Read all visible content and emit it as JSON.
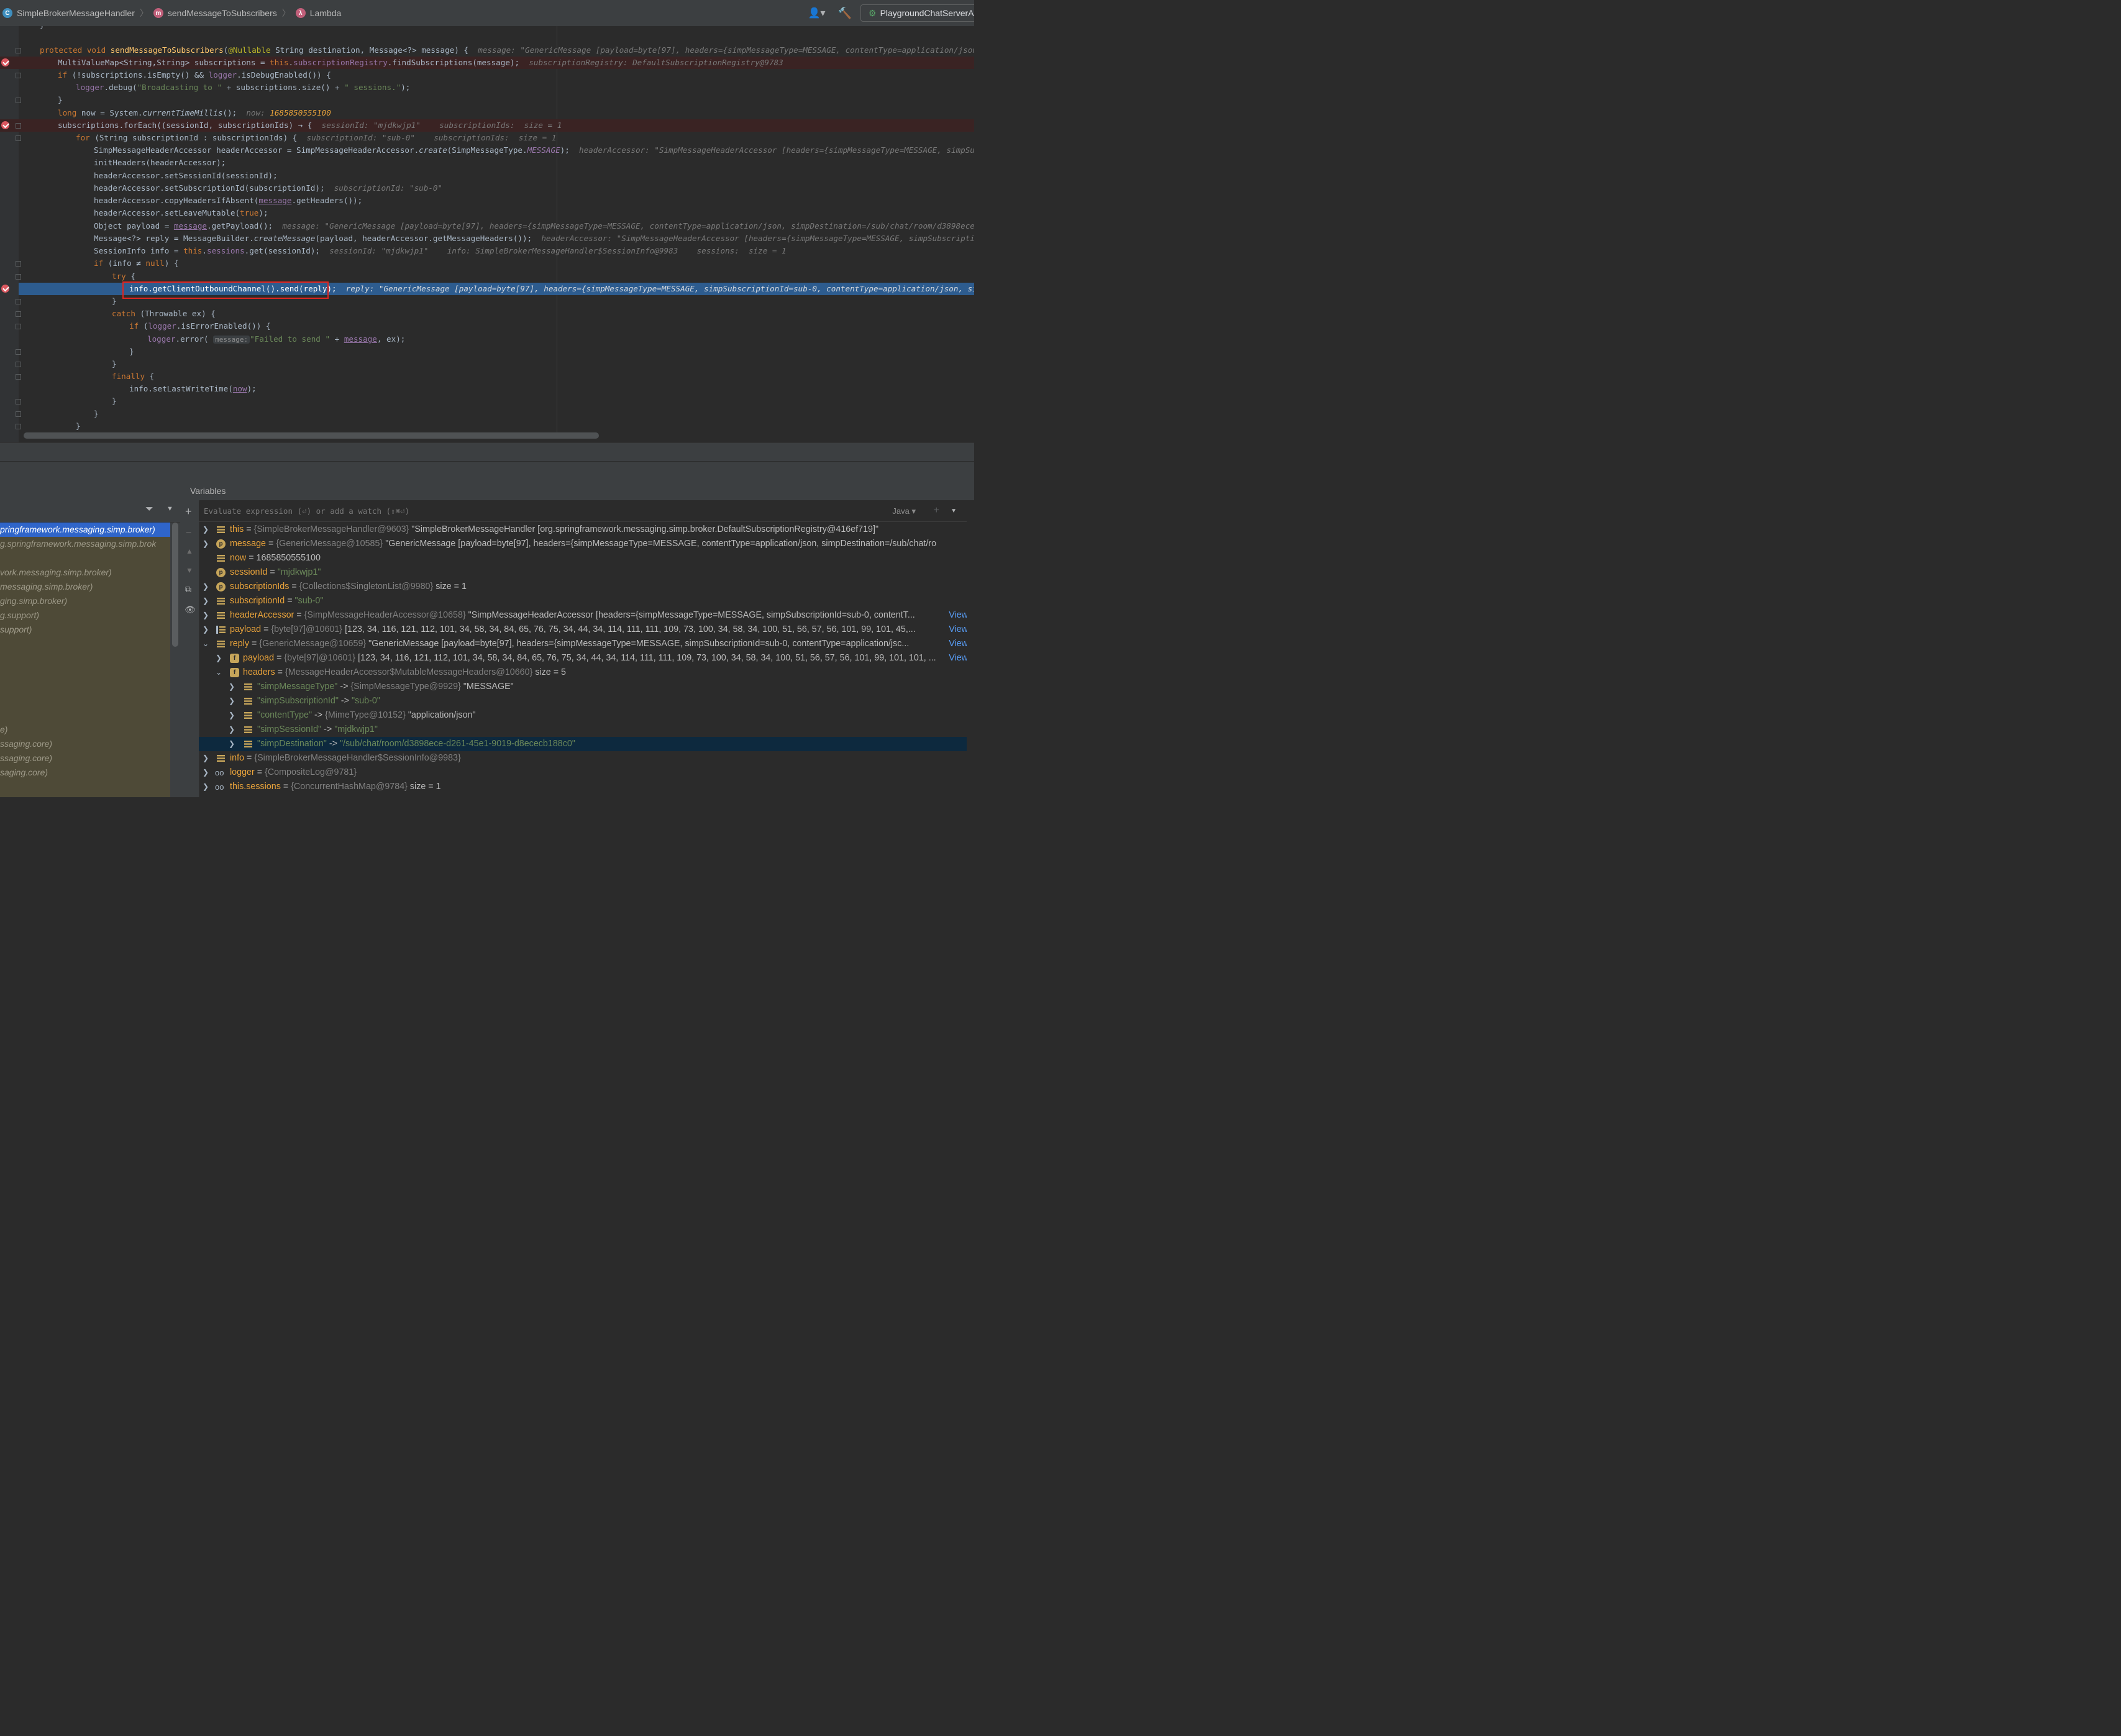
{
  "breadcrumb": {
    "items": [
      {
        "icon": "class-icon",
        "label": "SimpleBrokerMessageHandler"
      },
      {
        "icon": "method-icon",
        "label": "sendMessageToSubscribers"
      },
      {
        "icon": "lambda-icon",
        "label": "Lambda"
      }
    ]
  },
  "toolbar": {
    "run_config": "PlaygroundChatServerAp"
  },
  "code": {
    "l1_kw": "protected void ",
    "l1_fn": "sendMessageToSubscribers",
    "l1_ann": "@Nullable",
    "l1_rest": " String destination, Message<?> message) {",
    "l1_hint": "message: \"GenericMessage [payload=byte[97], headers={simpMessageType=MESSAGE, contentType=application/json, simpDest",
    "l2_a": "MultiValueMap<String,String> subscriptions = ",
    "l2_this": "this",
    "l2_dot": ".",
    "l2_fld": "subscriptionRegistry",
    "l2_rest": ".findSubscriptions(message);",
    "l2_hint": "subscriptionRegistry: DefaultSubscriptionRegistry@9783",
    "l3_kw": "if",
    "l3_a": " (!subscriptions.isEmpty() && ",
    "l3_fld": "logger",
    "l3_rest": ".isDebugEnabled()) {",
    "l4_fld": "logger",
    "l4_a": ".debug(",
    "l4_str1": "\"Broadcasting to \"",
    "l4_b": " + subscriptions.size() + ",
    "l4_str2": "\" sessions.\"",
    "l4_c": ");",
    "l5": "}",
    "l6_kw": "long",
    "l6_a": " now = System.",
    "l6_it": "currentTimeMillis",
    "l6_b": "();",
    "l6_hint": "now: ",
    "l6_hint_val": "1685850555100",
    "l7_a": "subscriptions.forEach((sessionId, subscriptionIds) → {",
    "l7_hint": "sessionId: \"mjdkwjp1\"    subscriptionIds:  size = 1",
    "l8_kw": "for",
    "l8_a": " (String subscriptionId : subscriptionIds) {",
    "l8_hint": "subscriptionId: \"sub-0\"    subscriptionIds:  size = 1",
    "l9_a": "SimpMessageHeaderAccessor headerAccessor = SimpMessageHeaderAccessor.",
    "l9_it": "create",
    "l9_b": "(SimpMessageType.",
    "l9_fld": "MESSAGE",
    "l9_c": ");",
    "l9_hint": "headerAccessor: \"SimpMessageHeaderAccessor [headers={simpMessageType=MESSAGE, simpSubscription",
    "l10": "initHeaders(headerAccessor);",
    "l11": "headerAccessor.setSessionId(sessionId);",
    "l12": "headerAccessor.setSubscriptionId(subscriptionId);",
    "l12_hint": "subscriptionId: \"sub-0\"",
    "l13_a": "headerAccessor.copyHeadersIfAbsent(",
    "l13_ul": "message",
    "l13_b": ".getHeaders());",
    "l14_a": "headerAccessor.setLeaveMutable(",
    "l14_kw": "true",
    "l14_b": ");",
    "l15_a": "Object payload = ",
    "l15_ul": "message",
    "l15_b": ".getPayload();",
    "l15_hint": "message: \"GenericMessage [payload=byte[97], headers={simpMessageType=MESSAGE, contentType=application/json, simpDestination=/sub/chat/room/d3898ece-d261-45e1-",
    "l16_a": "Message<?> reply = MessageBuilder.",
    "l16_it": "createMessage",
    "l16_b": "(payload, headerAccessor.getMessageHeaders());",
    "l16_hint": "headerAccessor: \"SimpMessageHeaderAccessor [headers={simpMessageType=MESSAGE, simpSubscriptionId=sub-0,",
    "l17_a": "SessionInfo info = ",
    "l17_kw": "this",
    "l17_b": ".",
    "l17_fld": "sessions",
    "l17_c": ".get(sessionId);",
    "l17_hint": "sessionId: \"mjdkwjp1\"    info: SimpleBrokerMessageHandler$SessionInfo@9983    sessions:  size = 1",
    "l18_kw": "if",
    "l18_a": " (info ≠ ",
    "l18_kw2": "null",
    "l18_b": ") {",
    "l19_kw": "try",
    "l19_a": " {",
    "l20_a": "info.getClientOutboundChannel().send(reply);",
    "l20_hint": "reply: \"GenericMessage [payload=byte[97], headers={simpMessageType=MESSAGE, simpSubscriptionId=sub-0, contentType=application/json, simpSession",
    "l21": "}",
    "l22_kw": "catch",
    "l22_a": " (Throwable ex) {",
    "l23_kw": "if",
    "l23_a": " (",
    "l23_fld": "logger",
    "l23_b": ".isErrorEnabled()) {",
    "l24_fld": "logger",
    "l24_a": ".error(",
    "l24_ph": "message:",
    "l24_str": "\"Failed to send \"",
    "l24_b": " + ",
    "l24_ul": "message",
    "l24_c": ", ex);",
    "l25": "}",
    "l26": "}",
    "l27_kw": "finally",
    "l27_a": " {",
    "l28_a": "info.setLastWriteTime(",
    "l28_ul": "now",
    "l28_b": ");",
    "l29": "}",
    "l30": "}",
    "l31": "}",
    "l0": "}"
  },
  "variables_panel": {
    "title": "Variables",
    "eval_placeholder": "Evaluate expression (⏎) or add a watch (⇧⌘⏎)",
    "language": "Java ▾",
    "view_label": "View",
    "rows": [
      {
        "name": "this",
        "eq": " = ",
        "type": "{SimpleBrokerMessageHandler@9603}",
        "value": " \"SimpleBrokerMessageHandler [org.springframework.messaging.simp.broker.DefaultSubscriptionRegistry@416ef719]\""
      },
      {
        "name": "message",
        "eq": " = ",
        "type": "{GenericMessage@10585}",
        "value": " \"GenericMessage [payload=byte[97], headers={simpMessageType=MESSAGE, contentType=application/json, simpDestination=/sub/chat/ro"
      },
      {
        "name": "now",
        "eq": " = ",
        "type": "",
        "value": "1685850555100"
      },
      {
        "name": "sessionId",
        "eq": " = ",
        "type": "",
        "value": "\"mjdkwjp1\""
      },
      {
        "name": "subscriptionIds",
        "eq": " = ",
        "type": "{Collections$SingletonList@9980}",
        "value": "  size = 1"
      },
      {
        "name": "subscriptionId",
        "eq": " = ",
        "type": "",
        "value": "\"sub-0\""
      },
      {
        "name": "headerAccessor",
        "eq": " = ",
        "type": "{SimpMessageHeaderAccessor@10658}",
        "value": " \"SimpMessageHeaderAccessor [headers={simpMessageType=MESSAGE, simpSubscriptionId=sub-0, contentT..."
      },
      {
        "name": "payload",
        "eq": " = ",
        "type": "{byte[97]@10601}",
        "value": " [123, 34, 116, 121, 112, 101, 34, 58, 34, 84, 65, 76, 75, 34, 44, 34, 114, 111, 111, 109, 73, 100, 34, 58, 34, 100, 51, 56, 57, 56, 101, 99, 101, 45,..."
      },
      {
        "name": "reply",
        "eq": " = ",
        "type": "{GenericMessage@10659}",
        "value": " \"GenericMessage [payload=byte[97], headers={simpMessageType=MESSAGE, simpSubscriptionId=sub-0, contentType=application/jsc..."
      },
      {
        "name": "payload",
        "eq": " = ",
        "type": "{byte[97]@10601}",
        "value": " [123, 34, 116, 121, 112, 101, 34, 58, 34, 84, 65, 76, 75, 34, 44, 34, 114, 111, 111, 109, 73, 100, 34, 58, 34, 100, 51, 56, 57, 56, 101, 99, 101, 101, ..."
      },
      {
        "name": "headers",
        "eq": " = ",
        "type": "{MessageHeaderAccessor$MutableMessageHeaders@10660}",
        "value": "  size = 5"
      },
      {
        "name": "\"simpMessageType\"",
        "eq": " -> ",
        "type": "{SimpMessageType@9929}",
        "value": " \"MESSAGE\""
      },
      {
        "name": "\"simpSubscriptionId\"",
        "eq": " -> ",
        "type": "",
        "value": "\"sub-0\""
      },
      {
        "name": "\"contentType\"",
        "eq": " -> ",
        "type": "{MimeType@10152}",
        "value": " \"application/json\""
      },
      {
        "name": "\"simpSessionId\"",
        "eq": " -> ",
        "type": "",
        "value": "\"mjdkwjp1\""
      },
      {
        "name": "\"simpDestination\"",
        "eq": " -> ",
        "type": "",
        "value": "\"/sub/chat/room/d3898ece-d261-45e1-9019-d8ececb188c0\""
      },
      {
        "name": "info",
        "eq": " = ",
        "type": "{SimpleBrokerMessageHandler$SessionInfo@9983}",
        "value": ""
      },
      {
        "name": "logger",
        "eq": " = ",
        "type": "{CompositeLog@9781}",
        "value": ""
      },
      {
        "name": "this.sessions",
        "eq": " = ",
        "type": "{ConcurrentHashMap@9784}",
        "value": "  size = 1"
      }
    ]
  },
  "frames_panel": {
    "items": [
      "pringframework.messaging.simp.broker)",
      "g.springframework.messaging.simp.brok",
      "",
      "vork.messaging.simp.broker)",
      "messaging.simp.broker)",
      "ging.simp.broker)",
      "g.support)",
      "support)",
      "",
      "",
      "",
      "",
      "",
      "",
      "e)",
      "ssaging.core)",
      "ssaging.core)",
      "saging.core)"
    ]
  },
  "colors": {
    "editor_bg": "#2b2b2b",
    "keyword": "#cc7832",
    "string": "#6a8759",
    "field": "#9876aa",
    "exec_line": "#2d5c8f",
    "breakpoint": "#db5860",
    "highlight_box": "#e0251f"
  }
}
